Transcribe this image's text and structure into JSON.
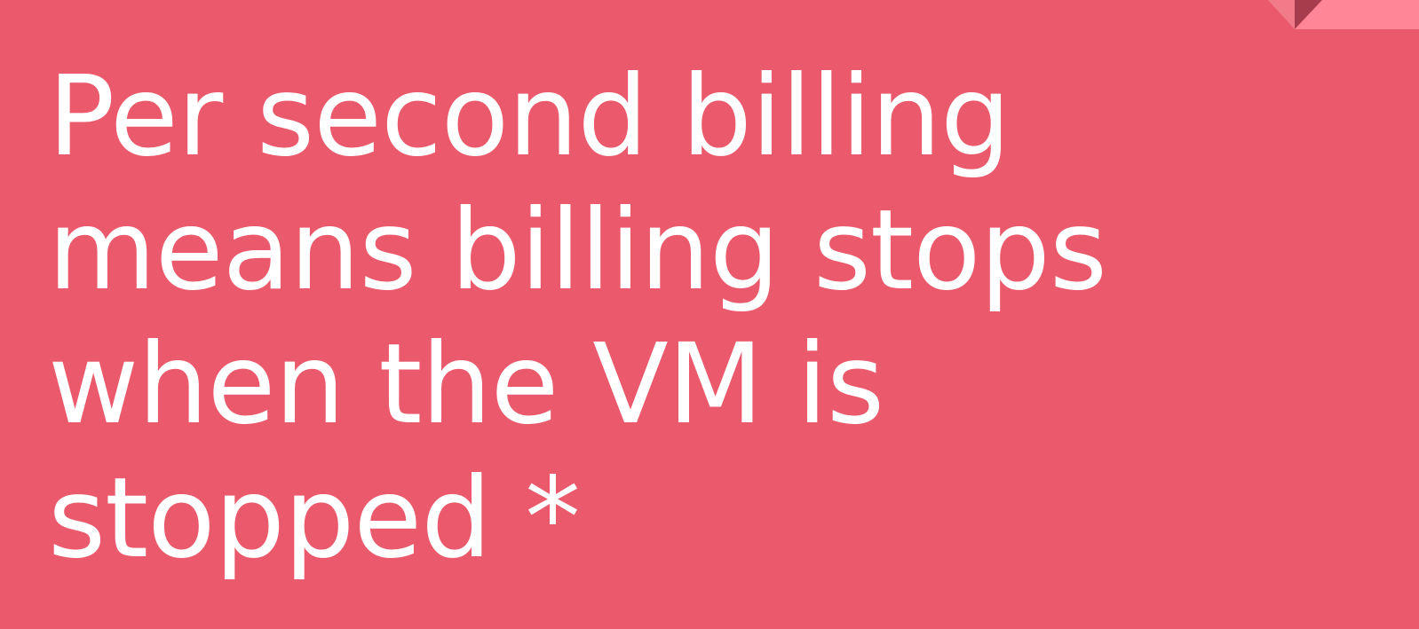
{
  "slide": {
    "background_color": "#EB5A6C",
    "lines": [
      "Per second billing",
      "means billing stops",
      "when the VM is",
      "stopped *"
    ]
  },
  "corner_decoration": {
    "icon": "folded-corner-icon",
    "colors": {
      "light_fold": "#FF8696",
      "dark_fold": "#A73D4C",
      "soft_fold": "#F27B89"
    }
  }
}
